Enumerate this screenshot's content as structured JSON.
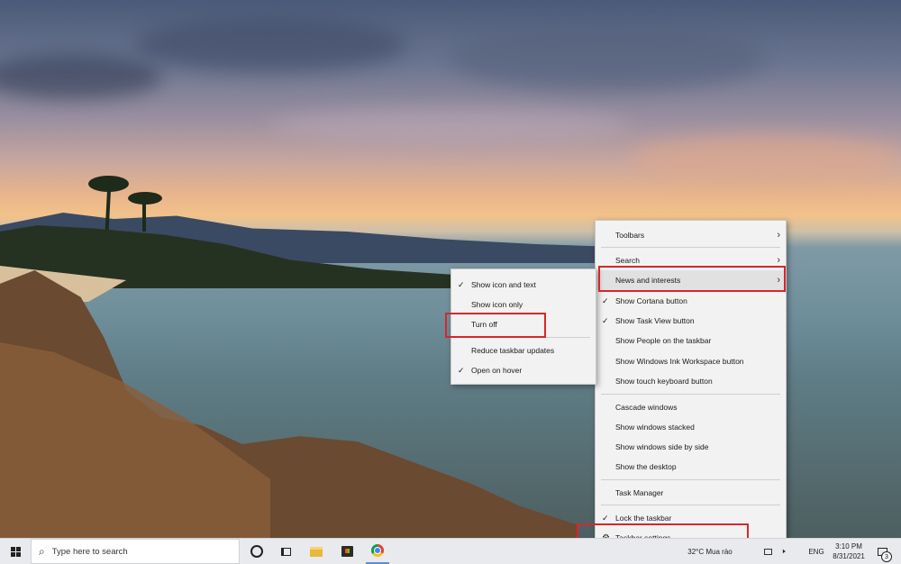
{
  "context_menu": {
    "items": [
      {
        "label": "Toolbars",
        "checked": false,
        "submenu": true
      },
      {
        "label": "Search",
        "checked": false,
        "submenu": true
      },
      {
        "label": "News and interests",
        "checked": false,
        "submenu": true
      },
      {
        "label": "Show Cortana button",
        "checked": true,
        "submenu": false
      },
      {
        "label": "Show Task View button",
        "checked": true,
        "submenu": false
      },
      {
        "label": "Show People on the taskbar",
        "checked": false,
        "submenu": false
      },
      {
        "label": "Show Windows Ink Workspace button",
        "checked": false,
        "submenu": false
      },
      {
        "label": "Show touch keyboard button",
        "checked": false,
        "submenu": false
      },
      {
        "label": "Cascade windows",
        "checked": false,
        "submenu": false
      },
      {
        "label": "Show windows stacked",
        "checked": false,
        "submenu": false
      },
      {
        "label": "Show windows side by side",
        "checked": false,
        "submenu": false
      },
      {
        "label": "Show the desktop",
        "checked": false,
        "submenu": false
      },
      {
        "label": "Task Manager",
        "checked": false,
        "submenu": false
      },
      {
        "label": "Lock the taskbar",
        "checked": true,
        "submenu": false
      },
      {
        "label": "Taskbar settings",
        "checked": false,
        "submenu": false,
        "icon": "gear-icon"
      }
    ]
  },
  "news_submenu": {
    "items": [
      {
        "label": "Show icon and text",
        "checked": true
      },
      {
        "label": "Show icon only",
        "checked": false
      },
      {
        "label": "Turn off",
        "checked": false
      },
      {
        "label": "Reduce taskbar updates",
        "checked": false
      },
      {
        "label": "Open on hover",
        "checked": true
      }
    ]
  },
  "taskbar": {
    "search_placeholder": "Type here to search",
    "pinned_icons": [
      "cortana-icon",
      "task-view-icon",
      "file-explorer-icon",
      "store-icon",
      "chrome-icon"
    ],
    "weather": "32°C  Mua rào",
    "language": "ENG",
    "time": "3:10 PM",
    "date": "8/31/2021",
    "notification_count": "3"
  },
  "colors": {
    "highlight_box": "#d7262c",
    "menu_bg": "#f2f2f2",
    "taskbar_bg": "#e8eaed"
  }
}
